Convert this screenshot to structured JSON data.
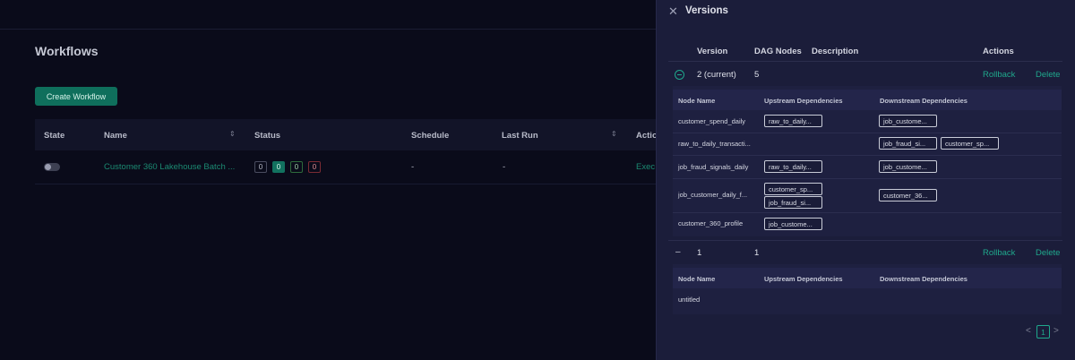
{
  "page": {
    "title": "Workflows",
    "create_button": "Create Workflow",
    "columns": [
      "State",
      "Name",
      "Status",
      "Schedule",
      "Last Run",
      "Actio"
    ],
    "row": {
      "name": "Customer 360 Lakehouse Batch ...",
      "status_counts": [
        "0",
        "0",
        "0",
        "0"
      ],
      "schedule": "-",
      "last_run": "-",
      "action": "Exec"
    }
  },
  "drawer": {
    "title": "Versions",
    "columns": [
      "Version",
      "DAG Nodes",
      "Description",
      "Actions"
    ],
    "versions": [
      {
        "version": "2 (current)",
        "dag_nodes": "5",
        "rollback": "Rollback",
        "delete": "Delete",
        "sub_columns": [
          "Node Name",
          "Upstream Dependencies",
          "Downstream Dependencies"
        ],
        "nodes": [
          {
            "name": "customer_spend_daily",
            "upstream": [
              "raw_to_daily..."
            ],
            "downstream": [
              "job_custome..."
            ]
          },
          {
            "name": "raw_to_daily_transacti...",
            "upstream": [],
            "downstream": [
              "job_fraud_si...",
              "customer_sp..."
            ]
          },
          {
            "name": "job_fraud_signals_daily",
            "upstream": [
              "raw_to_daily..."
            ],
            "downstream": [
              "job_custome..."
            ]
          },
          {
            "name": "job_customer_daily_f...",
            "upstream": [
              "customer_sp...",
              "job_fraud_si..."
            ],
            "downstream": [
              "customer_36..."
            ]
          },
          {
            "name": "customer_360_profile",
            "upstream": [
              "job_custome..."
            ],
            "downstream": []
          }
        ]
      },
      {
        "version": "1",
        "dag_nodes": "1",
        "rollback": "Rollback",
        "delete": "Delete",
        "sub_columns": [
          "Node Name",
          "Upstream Dependencies",
          "Downstream Dependencies"
        ],
        "nodes": [
          {
            "name": "untitled",
            "upstream": [],
            "downstream": []
          }
        ]
      }
    ],
    "pagination": {
      "prev": "<",
      "current": "1",
      "next": ">"
    }
  }
}
